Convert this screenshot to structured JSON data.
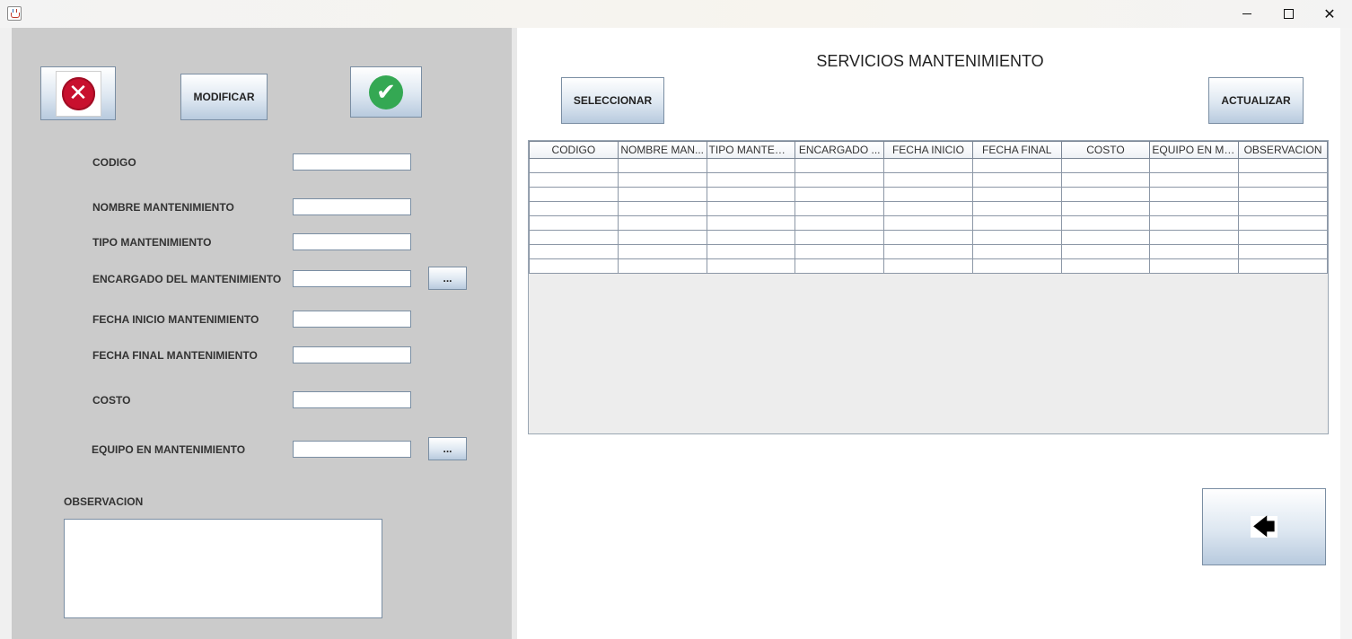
{
  "window": {
    "title": "",
    "icon": "java-app-icon"
  },
  "left_panel": {
    "buttons": {
      "cancel_icon": "red-x-circle-icon",
      "modify_label": "MODIFICAR",
      "confirm_icon": "green-check-circle-icon"
    },
    "fields": {
      "codigo": {
        "label": "CODIGO",
        "value": ""
      },
      "nombre": {
        "label": "NOMBRE MANTENIMIENTO",
        "value": ""
      },
      "tipo": {
        "label": "TIPO MANTENIMIENTO",
        "value": ""
      },
      "encargado": {
        "label": "ENCARGADO DEL MANTENIMIENTO",
        "value": "",
        "browse_label": "..."
      },
      "fecha_inicio": {
        "label": "FECHA INICIO MANTENIMIENTO",
        "value": ""
      },
      "fecha_final": {
        "label": "FECHA FINAL MANTENIMIENTO",
        "value": ""
      },
      "costo": {
        "label": "COSTO",
        "value": ""
      },
      "equipo": {
        "label": "EQUIPO EN MANTENIMIENTO",
        "value": "",
        "browse_label": "..."
      },
      "observacion": {
        "label": "OBSERVACION",
        "value": ""
      }
    }
  },
  "right_panel": {
    "title": "SERVICIOS MANTENIMIENTO",
    "select_label": "SELECCIONAR",
    "update_label": "ACTUALIZAR",
    "back_icon": "left-arrow-icon",
    "table": {
      "columns": [
        "CODIGO",
        "NOMBRE MAN...",
        "TIPO MANTENI...",
        "ENCARGADO ...",
        "FECHA INICIO",
        "FECHA FINAL",
        "COSTO",
        "EQUIPO EN MA...",
        "OBSERVACION"
      ],
      "rows": [
        [
          "",
          "",
          "",
          "",
          "",
          "",
          "",
          "",
          ""
        ],
        [
          "",
          "",
          "",
          "",
          "",
          "",
          "",
          "",
          ""
        ],
        [
          "",
          "",
          "",
          "",
          "",
          "",
          "",
          "",
          ""
        ],
        [
          "",
          "",
          "",
          "",
          "",
          "",
          "",
          "",
          ""
        ],
        [
          "",
          "",
          "",
          "",
          "",
          "",
          "",
          "",
          ""
        ],
        [
          "",
          "",
          "",
          "",
          "",
          "",
          "",
          "",
          ""
        ],
        [
          "",
          "",
          "",
          "",
          "",
          "",
          "",
          "",
          ""
        ],
        [
          "",
          "",
          "",
          "",
          "",
          "",
          "",
          "",
          ""
        ]
      ]
    }
  },
  "colors": {
    "left_panel_bg": "#cbcbcb",
    "button_gradient_end": "#b8cade",
    "cancel_red": "#c8102e",
    "confirm_green": "#34a853"
  }
}
